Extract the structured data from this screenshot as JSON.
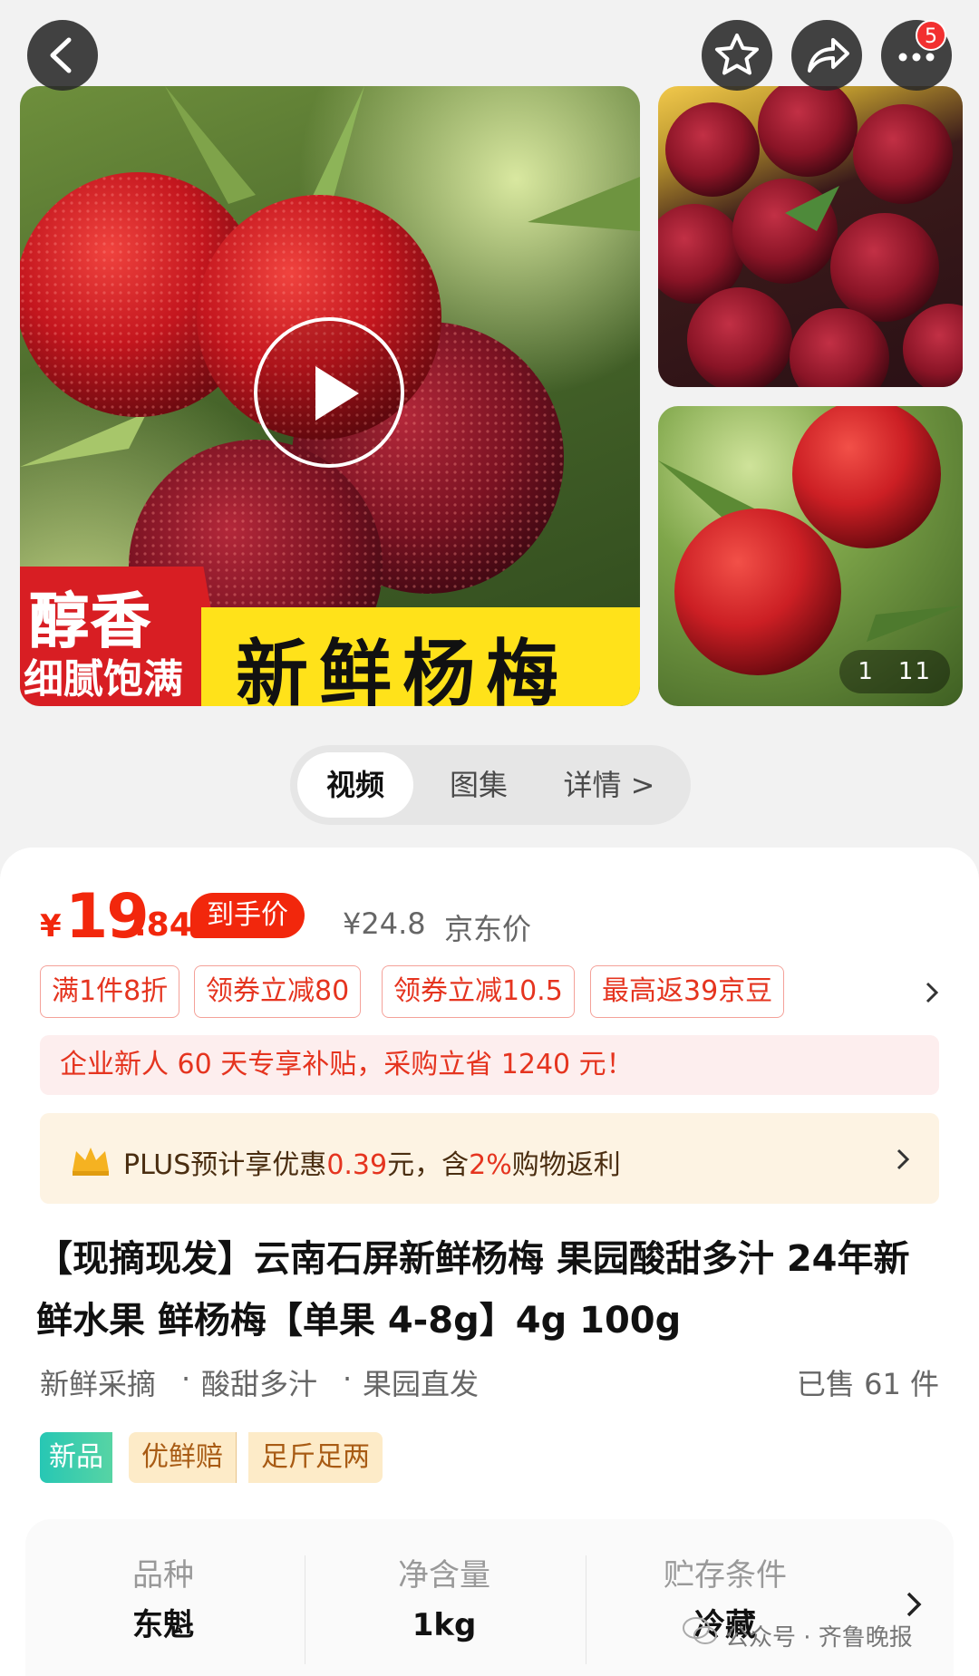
{
  "gallery": {
    "banner_line1": "醇香",
    "banner_line2": "细腻饱满",
    "banner_main": "新鲜杨梅",
    "counter_current": "1",
    "counter_total": "11",
    "notification_count": "5"
  },
  "tabs": [
    {
      "label": "视频",
      "active": true
    },
    {
      "label": "图集",
      "active": false
    },
    {
      "label": "详情 >",
      "active": false
    }
  ],
  "price": {
    "currency": "¥",
    "integer": "19",
    "decimal": ".84",
    "tag": "到手价",
    "original": "¥24.8",
    "original_label": "京东价",
    "accent_color": "#f2270c"
  },
  "coupons": [
    "满1件8折",
    "领券立减80",
    "领券立减10.5",
    "最高返39京豆"
  ],
  "subsidy_text": "企业新人 60 天专享补贴，采购立省 1240 元！",
  "plus": {
    "prefix": "PLUS预计享优惠",
    "amount": "0.39",
    "mid": "元，含",
    "percent": "2%",
    "suffix": "购物返利"
  },
  "product_title": "【现摘现发】云南石屏新鲜杨梅 果园酸甜多汁 24年新鲜水果 鲜杨梅【单果 4-8g】4g 100g",
  "features": [
    "新鲜采摘",
    "酸甜多汁",
    "果园直发"
  ],
  "sold": "已售 61 件",
  "badges": {
    "new": "新品",
    "guarantee1": "优鲜赔",
    "guarantee2": "足斤足两"
  },
  "specs": [
    {
      "label": "品种",
      "value": "东魁"
    },
    {
      "label": "净含量",
      "value": "1kg"
    },
    {
      "label": "贮存条件",
      "value": "冷藏"
    }
  ],
  "watermark": "公众号 · 齐鲁晚报"
}
